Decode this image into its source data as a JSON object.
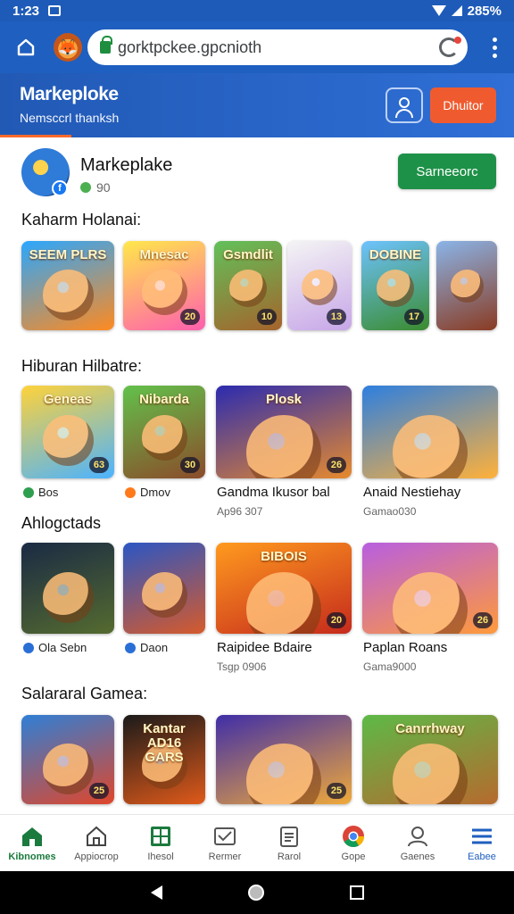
{
  "status_bar": {
    "time": "1:23",
    "battery": "285%"
  },
  "browser": {
    "url": "gorktpckee.gpcnioth"
  },
  "app_header": {
    "title": "Markeploke",
    "subtitle": "Nemsccrl thanksh",
    "button_label": "Dhuitor"
  },
  "store": {
    "name": "Markeplake",
    "meta": "90",
    "follow_label": "Sarneeorc"
  },
  "sections": [
    {
      "title": "Kaharm Holanai:",
      "tiles": [
        {
          "title": "SEEM PLRS",
          "badge": "",
          "c1": "#2aa7ff",
          "c2": "#ff8a1f"
        },
        {
          "title": "Mnesac",
          "badge": "20",
          "c1": "#ffe84a",
          "c2": "#ff5fae"
        },
        {
          "title": "Gsmdlit",
          "badge": "10",
          "c1": "#61c15a",
          "c2": "#a5632c"
        },
        {
          "title": "",
          "badge": "13",
          "c1": "#f4f4f4",
          "c2": "#c7a6e8"
        },
        {
          "title": "DOBINE",
          "badge": "17",
          "c1": "#6dc3ff",
          "c2": "#3a8b2e"
        },
        {
          "title": "",
          "badge": "",
          "c1": "#8ab4e8",
          "c2": "#8a3b22"
        }
      ]
    },
    {
      "title": "Hiburan Hilbatre:",
      "tiles": [
        {
          "title": "Geneas",
          "badge": "63",
          "c1": "#ffd23a",
          "c2": "#4bb3ff",
          "cap": "Bos",
          "capc": "#2e9e4f"
        },
        {
          "title": "Nibarda",
          "badge": "30",
          "c1": "#62c14b",
          "c2": "#8b4b2a",
          "cap": "Dmov",
          "capc": "#ff7a1a"
        },
        {
          "title": "Plosk",
          "badge": "26",
          "c1": "#2b2bb0",
          "c2": "#e68a2e",
          "cap_title": "Gandma Ikusor bal",
          "cap_sub": "Ap96 307"
        },
        {
          "title": "",
          "badge": "",
          "c1": "#2d7fe0",
          "c2": "#ffb13a",
          "cap_title": "Anaid Nestiehay",
          "cap_sub": "Gamao030"
        }
      ]
    },
    {
      "title": "Ahlogctads",
      "tiles": [
        {
          "title": "",
          "badge": "",
          "c1": "#1a2a44",
          "c2": "#556b2f",
          "cap": "Ola Sebn",
          "capc": "#2a6fd6"
        },
        {
          "title": "",
          "badge": "",
          "c1": "#2b56c4",
          "c2": "#d65a2b",
          "cap": "Daon",
          "capc": "#2a6fd6"
        },
        {
          "title": "BIBOIS",
          "badge": "20",
          "c1": "#ff9a1f",
          "c2": "#c52a1c",
          "cap_title": "Raipidee Bdaire",
          "cap_sub": "Tsgp 0906"
        },
        {
          "title": "",
          "badge": "26",
          "c1": "#b85ee0",
          "c2": "#ff9a3a",
          "cap_title": "Paplan Roans",
          "cap_sub": "Gama9000"
        }
      ]
    },
    {
      "title": "Salararal Gamea:",
      "tiles": [
        {
          "title": "",
          "badge": "25",
          "c1": "#2f7fd6",
          "c2": "#e0462a"
        },
        {
          "title": "Kantar AD16 GARS",
          "badge": "",
          "c1": "#1a1a1a",
          "c2": "#e05a1a"
        },
        {
          "title": "",
          "badge": "25",
          "c1": "#3f2ea8",
          "c2": "#f0a93a"
        },
        {
          "title": "Canrrhway",
          "badge": "",
          "c1": "#5db947",
          "c2": "#b66a2e"
        }
      ]
    }
  ],
  "bottom_nav": [
    {
      "label": "Kibnomes",
      "icon": "home-icon"
    },
    {
      "label": "Appiocrop",
      "icon": "house-outline-icon"
    },
    {
      "label": "Ihesol",
      "icon": "grid-icon"
    },
    {
      "label": "Rermer",
      "icon": "mail-icon"
    },
    {
      "label": "Rarol",
      "icon": "clipboard-icon"
    },
    {
      "label": "Gope",
      "icon": "chrome-icon"
    },
    {
      "label": "Gaenes",
      "icon": "person-icon"
    },
    {
      "label": "Eabee",
      "icon": "menu-icon"
    }
  ]
}
